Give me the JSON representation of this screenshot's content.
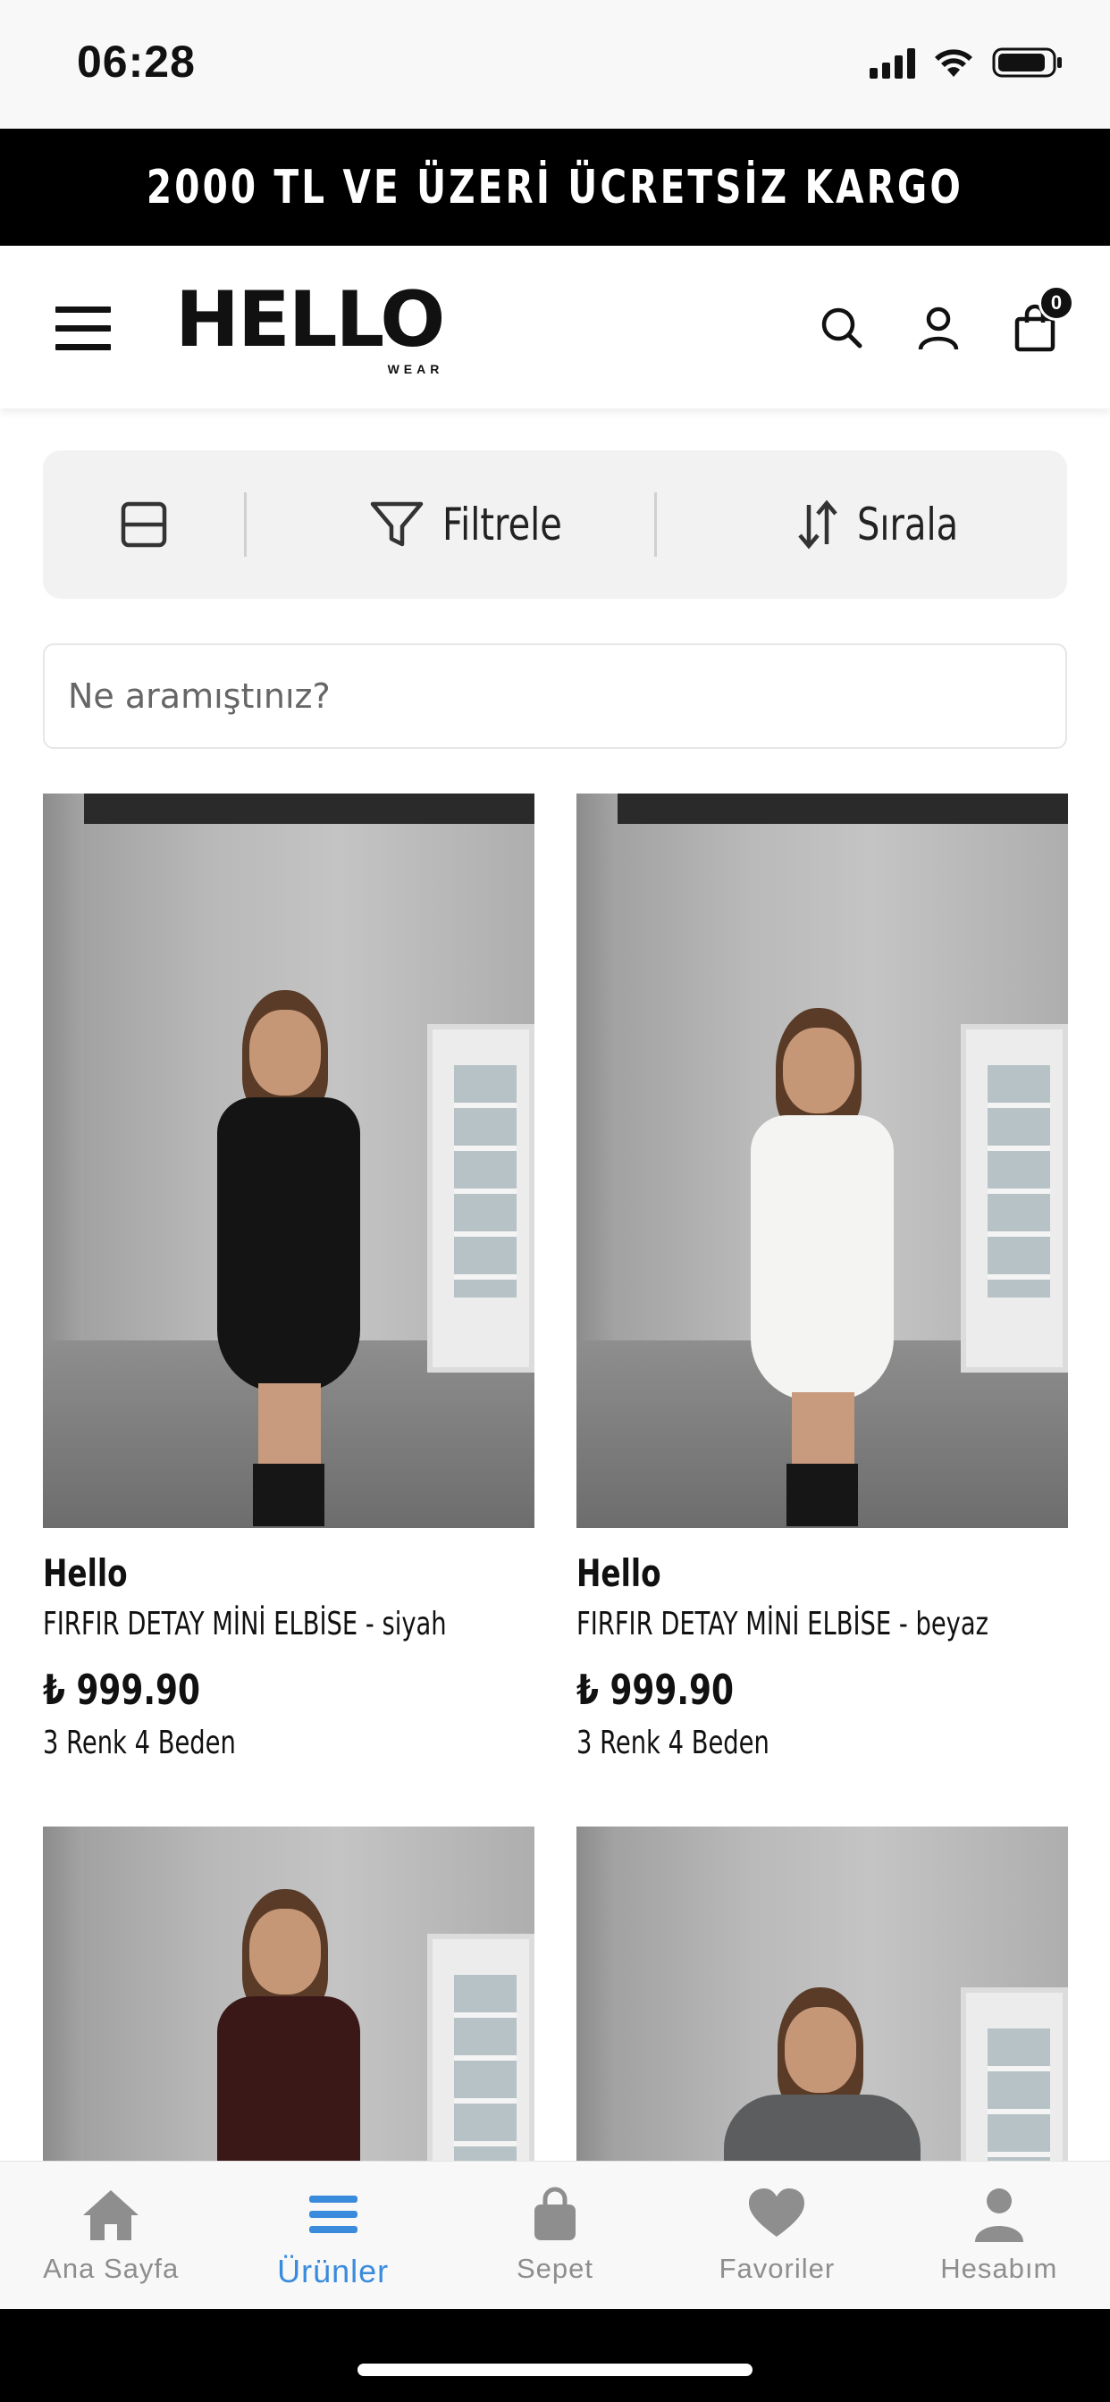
{
  "status_bar": {
    "time": "06:28"
  },
  "promo": {
    "text": "2000 TL VE ÜZERİ ÜCRETSİZ KARGO"
  },
  "header": {
    "logo": "HELLO",
    "logo_sub": "WEAR",
    "cart_count": "0",
    "icons": [
      "menu-icon",
      "search-icon",
      "user-icon",
      "shopping-bag-icon"
    ]
  },
  "toolbar": {
    "layout_icon": "grid-layout-icon",
    "filter_label": "Filtrele",
    "sort_label": "Sırala"
  },
  "search": {
    "placeholder": "Ne aramıştınız?"
  },
  "products": [
    {
      "brand": "Hello",
      "name": "FIRFIR DETAY MİNİ ELBİSE - siyah",
      "price": "₺ 999.90",
      "variants": "3 Renk 4 Beden",
      "color": "#141414"
    },
    {
      "brand": "Hello",
      "name": "FIRFIR DETAY MİNİ ELBİSE - beyaz",
      "price": "₺ 999.90",
      "variants": "3 Renk 4 Beden",
      "color": "#f4f4f2"
    },
    {
      "color": "#3a1818"
    },
    {
      "color": "#5b5d5f"
    }
  ],
  "bottom_nav": {
    "items": [
      {
        "label": "Ana Sayfa",
        "icon": "home-icon",
        "active": false
      },
      {
        "label": "Ürünler",
        "icon": "list-icon",
        "active": true
      },
      {
        "label": "Sepet",
        "icon": "bag-icon",
        "active": false
      },
      {
        "label": "Favoriler",
        "icon": "heart-icon",
        "active": false
      },
      {
        "label": "Hesabım",
        "icon": "person-icon",
        "active": false
      }
    ],
    "active_color": "#3b8bdd",
    "inactive_color": "#8e8e8e"
  }
}
